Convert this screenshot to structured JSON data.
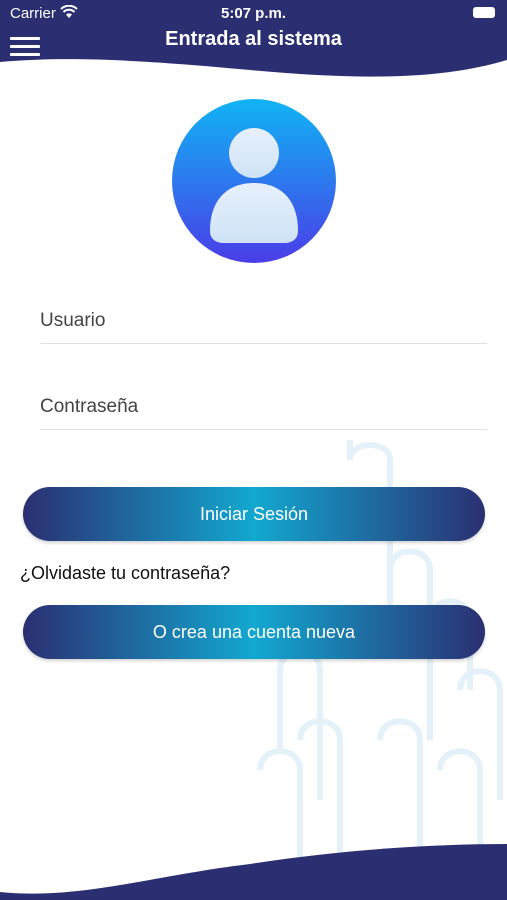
{
  "status_bar": {
    "carrier": "Carrier",
    "time": "5:07 p.m."
  },
  "header": {
    "title": "Entrada al sistema"
  },
  "form": {
    "username_placeholder": "Usuario",
    "password_placeholder": "Contraseña",
    "login_label": "Iniciar Sesión",
    "forgot_label": "¿Olvidaste tu contraseña?",
    "register_label": "O crea una cuenta nueva"
  },
  "icons": {
    "menu": "hamburger-menu-icon",
    "avatar": "user-avatar-icon",
    "wifi": "wifi-icon",
    "battery": "battery-icon"
  },
  "colors": {
    "brand_dark": "#2b2f72",
    "brand_accent": "#12a8d0",
    "avatar_top": "#10b4f4",
    "avatar_bottom": "#4a3de8"
  }
}
